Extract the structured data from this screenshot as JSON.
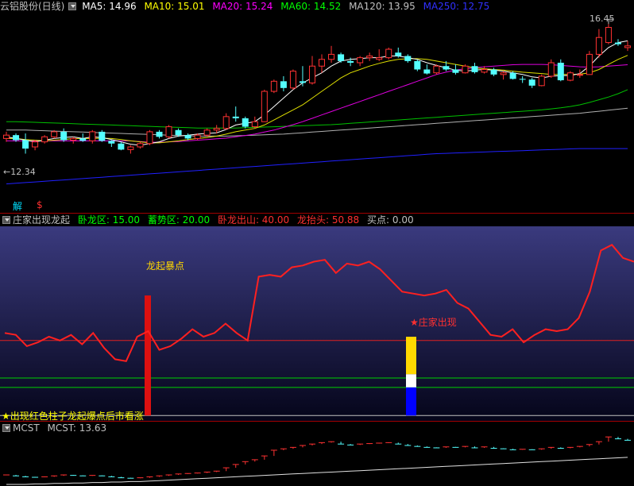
{
  "main": {
    "title": "云铝股份(日线)",
    "ma": [
      {
        "label": "MA5: 14.96",
        "color": "#ffffff"
      },
      {
        "label": "MA10: 15.01",
        "color": "#ffff00"
      },
      {
        "label": "MA20: 15.24",
        "color": "#ff00ff"
      },
      {
        "label": "MA60: 14.52",
        "color": "#00ff00"
      },
      {
        "label": "MA120: 13.95",
        "color": "#c0c0c0"
      },
      {
        "label": "MA250: 12.75",
        "color": "#3030ff"
      }
    ],
    "high_label": "16.45",
    "low_label": "12.34",
    "jie": "解",
    "dollar": "$",
    "candles": [
      [
        13.05,
        13.25,
        12.95,
        13.15
      ],
      [
        13.15,
        13.2,
        12.95,
        13.0
      ],
      [
        13.0,
        13.2,
        12.6,
        12.75
      ],
      [
        12.8,
        13.0,
        12.7,
        12.95
      ],
      [
        12.95,
        13.15,
        12.9,
        13.1
      ],
      [
        13.1,
        13.3,
        13.05,
        13.25
      ],
      [
        13.25,
        13.35,
        12.95,
        13.0
      ],
      [
        13.0,
        13.1,
        12.9,
        13.05
      ],
      [
        13.05,
        13.2,
        12.95,
        12.98
      ],
      [
        12.98,
        13.3,
        12.9,
        13.25
      ],
      [
        13.25,
        13.3,
        12.95,
        12.98
      ],
      [
        12.98,
        13.0,
        12.8,
        12.9
      ],
      [
        12.9,
        12.95,
        12.7,
        12.72
      ],
      [
        12.72,
        12.85,
        12.6,
        12.8
      ],
      [
        12.8,
        12.95,
        12.75,
        12.9
      ],
      [
        12.9,
        13.3,
        12.85,
        13.25
      ],
      [
        13.25,
        13.3,
        13.05,
        13.1
      ],
      [
        13.1,
        13.45,
        13.05,
        13.4
      ],
      [
        13.3,
        13.35,
        13.1,
        13.15
      ],
      [
        13.15,
        13.2,
        13.0,
        13.05
      ],
      [
        13.05,
        13.2,
        13.0,
        13.15
      ],
      [
        13.15,
        13.35,
        13.1,
        13.3
      ],
      [
        13.3,
        13.45,
        13.2,
        13.35
      ],
      [
        13.35,
        13.8,
        13.3,
        13.7
      ],
      [
        13.7,
        14.0,
        13.55,
        13.65
      ],
      [
        13.65,
        13.7,
        13.35,
        13.4
      ],
      [
        13.4,
        13.7,
        13.35,
        13.55
      ],
      [
        13.55,
        14.5,
        13.55,
        14.45
      ],
      [
        14.45,
        14.8,
        14.4,
        14.75
      ],
      [
        14.75,
        14.9,
        14.45,
        14.55
      ],
      [
        14.55,
        15.1,
        14.5,
        15.05
      ],
      [
        14.75,
        15.2,
        14.6,
        14.7
      ],
      [
        14.7,
        15.5,
        14.65,
        15.2
      ],
      [
        15.2,
        15.55,
        15.0,
        15.4
      ],
      [
        15.4,
        15.8,
        15.3,
        15.55
      ],
      [
        15.55,
        15.6,
        15.3,
        15.35
      ],
      [
        15.35,
        15.45,
        15.2,
        15.3
      ],
      [
        15.3,
        15.5,
        15.2,
        15.45
      ],
      [
        15.45,
        15.6,
        15.35,
        15.5
      ],
      [
        15.4,
        15.7,
        15.35,
        15.45
      ],
      [
        15.45,
        15.75,
        15.4,
        15.7
      ],
      [
        15.6,
        15.75,
        15.45,
        15.5
      ],
      [
        15.5,
        15.55,
        15.3,
        15.35
      ],
      [
        15.35,
        15.4,
        15.05,
        15.1
      ],
      [
        15.1,
        15.25,
        14.95,
        14.98
      ],
      [
        15.0,
        15.25,
        14.95,
        15.2
      ],
      [
        15.2,
        15.35,
        15.05,
        15.1
      ],
      [
        15.1,
        15.25,
        14.95,
        15.0
      ],
      [
        15.0,
        15.25,
        14.98,
        15.2
      ],
      [
        15.2,
        15.3,
        14.98,
        15.02
      ],
      [
        15.02,
        15.2,
        14.98,
        15.1
      ],
      [
        15.1,
        15.15,
        14.9,
        14.95
      ],
      [
        14.95,
        15.05,
        14.8,
        15.0
      ],
      [
        15.0,
        15.05,
        14.8,
        14.82
      ],
      [
        14.82,
        14.9,
        14.7,
        14.8
      ],
      [
        14.8,
        14.85,
        14.55,
        14.62
      ],
      [
        14.62,
        14.95,
        14.6,
        14.9
      ],
      [
        14.9,
        15.4,
        14.85,
        15.3
      ],
      [
        15.3,
        15.4,
        14.75,
        14.78
      ],
      [
        14.78,
        15.05,
        14.75,
        15.0
      ],
      [
        14.95,
        15.1,
        14.85,
        14.95
      ],
      [
        14.95,
        15.65,
        14.95,
        15.55
      ],
      [
        15.55,
        16.3,
        15.45,
        16.05
      ],
      [
        15.9,
        16.45,
        15.85,
        16.35
      ],
      [
        15.9,
        16.0,
        15.8,
        15.85
      ],
      [
        15.75,
        15.95,
        15.65,
        15.8
      ]
    ],
    "ma5": [
      13.1,
      13.05,
      13.0,
      12.95,
      13.0,
      13.05,
      13.08,
      13.1,
      13.05,
      13.1,
      13.08,
      13.02,
      12.95,
      12.88,
      12.85,
      12.9,
      12.95,
      13.05,
      13.12,
      13.15,
      13.18,
      13.2,
      13.22,
      13.32,
      13.45,
      13.5,
      13.55,
      13.75,
      14.0,
      14.25,
      14.5,
      14.7,
      14.85,
      15.0,
      15.2,
      15.35,
      15.4,
      15.42,
      15.45,
      15.45,
      15.5,
      15.5,
      15.45,
      15.4,
      15.3,
      15.22,
      15.15,
      15.08,
      15.05,
      15.08,
      15.1,
      15.08,
      15.05,
      15.0,
      14.95,
      14.88,
      14.85,
      14.9,
      14.92,
      14.92,
      14.98,
      15.2,
      15.5,
      15.75,
      15.9,
      15.95
    ],
    "ma10": [
      13.05,
      13.05,
      13.02,
      13.0,
      12.98,
      13.0,
      13.02,
      13.05,
      13.05,
      13.05,
      13.06,
      13.05,
      13.02,
      12.98,
      12.95,
      12.92,
      12.92,
      12.95,
      12.98,
      13.02,
      13.05,
      13.08,
      13.12,
      13.18,
      13.25,
      13.3,
      13.35,
      13.45,
      13.6,
      13.75,
      13.9,
      14.05,
      14.25,
      14.45,
      14.65,
      14.85,
      15.0,
      15.1,
      15.2,
      15.28,
      15.35,
      15.4,
      15.42,
      15.42,
      15.4,
      15.35,
      15.3,
      15.25,
      15.2,
      15.15,
      15.12,
      15.1,
      15.08,
      15.05,
      15.02,
      15.0,
      14.98,
      14.95,
      14.95,
      14.95,
      14.96,
      15.0,
      15.1,
      15.25,
      15.4,
      15.52
    ],
    "ma20": [
      12.98,
      12.98,
      12.98,
      12.98,
      12.98,
      12.98,
      12.98,
      12.98,
      12.98,
      12.98,
      12.98,
      12.98,
      12.98,
      12.98,
      12.96,
      12.94,
      12.94,
      12.95,
      12.96,
      12.98,
      13.0,
      13.02,
      13.04,
      13.06,
      13.1,
      13.14,
      13.18,
      13.24,
      13.3,
      13.38,
      13.46,
      13.55,
      13.65,
      13.75,
      13.85,
      13.95,
      14.05,
      14.15,
      14.25,
      14.35,
      14.45,
      14.55,
      14.65,
      14.75,
      14.85,
      14.95,
      15.02,
      15.08,
      15.12,
      15.15,
      15.18,
      15.2,
      15.22,
      15.24,
      15.25,
      15.25,
      15.25,
      15.24,
      15.22,
      15.2,
      15.18,
      15.17,
      15.18,
      15.2,
      15.22,
      15.24
    ],
    "ma60": [
      13.55,
      13.55,
      13.54,
      13.53,
      13.52,
      13.51,
      13.5,
      13.49,
      13.48,
      13.47,
      13.46,
      13.45,
      13.44,
      13.43,
      13.42,
      13.41,
      13.4,
      13.39,
      13.38,
      13.37,
      13.36,
      13.36,
      13.36,
      13.36,
      13.36,
      13.37,
      13.38,
      13.39,
      13.4,
      13.41,
      13.42,
      13.43,
      13.44,
      13.45,
      13.46,
      13.48,
      13.5,
      13.52,
      13.54,
      13.56,
      13.58,
      13.6,
      13.62,
      13.64,
      13.66,
      13.68,
      13.7,
      13.72,
      13.74,
      13.76,
      13.78,
      13.8,
      13.82,
      13.84,
      13.86,
      13.88,
      13.9,
      13.93,
      13.96,
      14.0,
      14.05,
      14.12,
      14.2,
      14.28,
      14.38,
      14.5
    ],
    "ma120": [
      13.3,
      13.3,
      13.3,
      13.29,
      13.28,
      13.27,
      13.26,
      13.25,
      13.24,
      13.23,
      13.22,
      13.21,
      13.2,
      13.19,
      13.18,
      13.17,
      13.16,
      13.15,
      13.14,
      13.13,
      13.12,
      13.12,
      13.12,
      13.12,
      13.13,
      13.14,
      13.15,
      13.16,
      13.17,
      13.18,
      13.2,
      13.22,
      13.24,
      13.26,
      13.28,
      13.3,
      13.32,
      13.34,
      13.36,
      13.38,
      13.4,
      13.42,
      13.44,
      13.46,
      13.48,
      13.5,
      13.52,
      13.54,
      13.56,
      13.58,
      13.6,
      13.62,
      13.64,
      13.66,
      13.68,
      13.7,
      13.72,
      13.74,
      13.76,
      13.78,
      13.8,
      13.83,
      13.86,
      13.89,
      13.92,
      13.95
    ],
    "ma250": [
      11.7,
      11.72,
      11.74,
      11.76,
      11.78,
      11.8,
      11.82,
      11.84,
      11.86,
      11.88,
      11.9,
      11.92,
      11.94,
      11.96,
      11.98,
      12.0,
      12.02,
      12.04,
      12.06,
      12.08,
      12.1,
      12.12,
      12.14,
      12.16,
      12.18,
      12.2,
      12.22,
      12.24,
      12.26,
      12.28,
      12.3,
      12.32,
      12.34,
      12.36,
      12.38,
      12.4,
      12.42,
      12.44,
      12.46,
      12.48,
      12.5,
      12.52,
      12.54,
      12.56,
      12.58,
      12.6,
      12.61,
      12.62,
      12.63,
      12.64,
      12.65,
      12.66,
      12.67,
      12.68,
      12.69,
      12.7,
      12.71,
      12.72,
      12.73,
      12.74,
      12.75,
      12.75,
      12.75,
      12.75,
      12.75,
      12.75
    ]
  },
  "ind": {
    "title": "庄家出现龙起",
    "vals": [
      {
        "label": "卧龙区: 15.00",
        "color": "#00ff00"
      },
      {
        "label": "蓄势区: 20.00",
        "color": "#00ff00"
      },
      {
        "label": "卧龙出山: 40.00",
        "color": "#ff3030"
      },
      {
        "label": "龙抬头: 50.88",
        "color": "#ff3030"
      },
      {
        "label": "买点: 0.00",
        "color": "#c0c0c0"
      }
    ],
    "line": [
      44,
      43,
      37,
      39,
      42,
      40,
      43,
      38,
      44,
      36,
      30,
      29,
      42,
      45,
      35,
      37,
      41,
      46,
      42,
      44,
      49,
      44,
      40,
      74,
      75,
      74,
      79,
      80,
      82,
      83,
      76,
      81,
      80,
      82,
      78,
      72,
      66,
      65,
      64,
      65,
      67,
      60,
      57,
      50,
      43,
      42,
      46,
      39,
      43,
      46,
      45,
      46,
      52,
      66,
      88,
      91,
      84,
      82
    ],
    "lbl_dragon": "龙起暴点",
    "lbl_zhuang": "★庄家出现",
    "footer": "★出现红色柱子龙起爆点后市看涨",
    "red_bar_value": 64,
    "zhuang_value": 42,
    "zhuang_yellow_from": 22,
    "zhuang_white_from": 15
  },
  "mcst": {
    "title": "MCST",
    "label": "MCST: 13.63",
    "color": "#c0c0c0",
    "sticks": [
      12.9,
      12.88,
      12.86,
      12.85,
      12.86,
      12.88,
      12.9,
      12.89,
      12.88,
      12.89,
      12.88,
      12.86,
      12.84,
      12.83,
      12.84,
      12.86,
      12.88,
      12.9,
      12.92,
      12.93,
      12.94,
      12.96,
      12.98,
      13.05,
      13.12,
      13.18,
      13.22,
      13.3,
      13.42,
      13.45,
      13.48,
      13.52,
      13.55,
      13.58,
      13.6,
      13.55,
      13.53,
      13.55,
      13.56,
      13.57,
      13.58,
      13.55,
      13.52,
      13.5,
      13.48,
      13.47,
      13.49,
      13.48,
      13.5,
      13.47,
      13.49,
      13.46,
      13.45,
      13.43,
      13.44,
      13.43,
      13.45,
      13.48,
      13.46,
      13.48,
      13.5,
      13.54,
      13.6,
      13.7,
      13.66,
      13.63
    ],
    "base": [
      12.7,
      12.7,
      12.7,
      12.71,
      12.71,
      12.72,
      12.72,
      12.73,
      12.73,
      12.74,
      12.74,
      12.75,
      12.75,
      12.76,
      12.76,
      12.77,
      12.78,
      12.79,
      12.8,
      12.81,
      12.82,
      12.83,
      12.84,
      12.85,
      12.86,
      12.87,
      12.88,
      12.89,
      12.9,
      12.91,
      12.92,
      12.93,
      12.94,
      12.95,
      12.96,
      12.97,
      12.98,
      12.99,
      13.0,
      13.01,
      13.02,
      13.03,
      13.04,
      13.05,
      13.06,
      13.07,
      13.08,
      13.09,
      13.1,
      13.11,
      13.12,
      13.13,
      13.14,
      13.15,
      13.16,
      13.17,
      13.18,
      13.19,
      13.2,
      13.21,
      13.22,
      13.23,
      13.24,
      13.25,
      13.26,
      13.27
    ]
  }
}
